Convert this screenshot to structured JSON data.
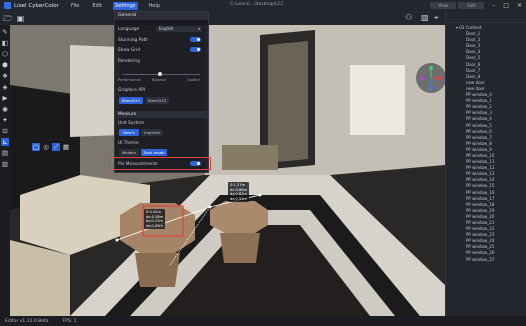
{
  "titlebar": {
    "app_title": "Lixel CyberColor",
    "menu": [
      "File",
      "Edit",
      "Settings",
      "Help"
    ],
    "active_menu": "Settings",
    "path": "C:/users/.../desktop/LCC",
    "btn1": "View",
    "btn2": "Edit"
  },
  "settings": {
    "header": "General",
    "language_label": "Language",
    "language_value": "English",
    "stunning_path_label": "Stunning Path",
    "show_grid_label": "Show Grid",
    "rendering_label": "Rendering",
    "ticks": [
      "Performance",
      "Balance",
      "Quality"
    ],
    "graphics_api_label": "Graphics API",
    "graphics_api_options": [
      "DirectX11",
      "DirectX12"
    ],
    "measure_label": "Measure",
    "unit_system_label": "Unit System",
    "unit_options": [
      "Metric",
      "Imperial"
    ],
    "ui_theme_label": "UI Theme",
    "theme_options": [
      "Modern",
      "Dark mode"
    ],
    "pin_label": "Pin Measurements"
  },
  "measure_labels": {
    "a": [
      "S:0.42m",
      "dx:0.38m",
      "dy:0.27m",
      "dz:0.05m"
    ],
    "b": [
      "S:1.27m",
      "dx:0.88m",
      "dy:0.82m",
      "dz:0.31m"
    ]
  },
  "tree": {
    "root": "03 Content",
    "items": [
      "Door_1",
      "Door_2",
      "Door_3",
      "Door_4",
      "Door_5",
      "Door_6",
      "Door_7",
      "Door_8",
      "new door",
      "new door",
      "PP window_0",
      "PP window_1",
      "PP window_2",
      "PP window_3",
      "PP window_4",
      "PP window_5",
      "PP window_6",
      "PP window_7",
      "PP window_8",
      "PP window_9",
      "PP window_10",
      "PP window_11",
      "PP window_12",
      "PP window_13",
      "PP window_14",
      "PP window_15",
      "PP window_16",
      "PP window_17",
      "PP window_18",
      "PP window_19",
      "PP window_20",
      "PP window_21",
      "PP window_22",
      "PP window_23",
      "PP window_24",
      "PP window_25",
      "PP window_26",
      "PP window_27"
    ]
  },
  "status": {
    "version": "Editor v1.11.0 Beta",
    "fps": "FPS: 1"
  }
}
